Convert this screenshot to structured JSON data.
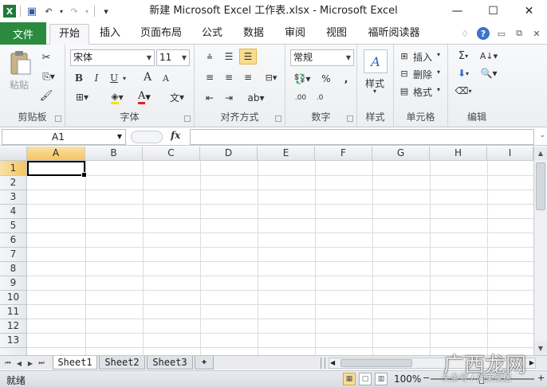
{
  "window": {
    "title": "新建 Microsoft Excel 工作表.xlsx  -  Microsoft Excel",
    "minimize": "—",
    "maximize": "☐",
    "close": "✕"
  },
  "qat": {
    "app_icon": "X",
    "save": "▣",
    "undo": "↶",
    "redo": "↷",
    "customize": "▾"
  },
  "tabs": {
    "file": "文件",
    "items": [
      "开始",
      "插入",
      "页面布局",
      "公式",
      "数据",
      "审阅",
      "视图",
      "福昕阅读器"
    ],
    "active_index": 0
  },
  "ribbon": {
    "clipboard": {
      "label": "剪贴板",
      "paste": "粘贴"
    },
    "font": {
      "label": "字体",
      "name": "宋体",
      "size": "11",
      "bold": "B",
      "italic": "I",
      "underline": "U",
      "grow": "A",
      "shrink": "A",
      "phonetic": "文"
    },
    "alignment": {
      "label": "对齐方式"
    },
    "number": {
      "label": "数字",
      "format": "常规",
      "percent": "%",
      "comma": ",",
      "inc_decimal": ".00",
      "dec_decimal": ".0"
    },
    "styles": {
      "label": "样式",
      "button": "样式"
    },
    "cells": {
      "label": "单元格",
      "insert": "插入",
      "delete": "删除",
      "format": "格式"
    },
    "editing": {
      "label": "编辑",
      "sum": "Σ"
    }
  },
  "formula_bar": {
    "name_box": "A1",
    "fx": "fx",
    "content": ""
  },
  "grid": {
    "columns": [
      "A",
      "B",
      "C",
      "D",
      "E",
      "F",
      "G",
      "H",
      "I"
    ],
    "rows": [
      "1",
      "2",
      "3",
      "4",
      "5",
      "6",
      "7",
      "8",
      "9",
      "10",
      "11",
      "12",
      "13"
    ],
    "active_cell": "A1"
  },
  "sheets": [
    "Sheet1",
    "Sheet2",
    "Sheet3"
  ],
  "status": {
    "ready": "就绪",
    "zoom": "100%"
  },
  "watermark": {
    "main": "广西龙网",
    "sub": "头条号 / 简美家居"
  }
}
